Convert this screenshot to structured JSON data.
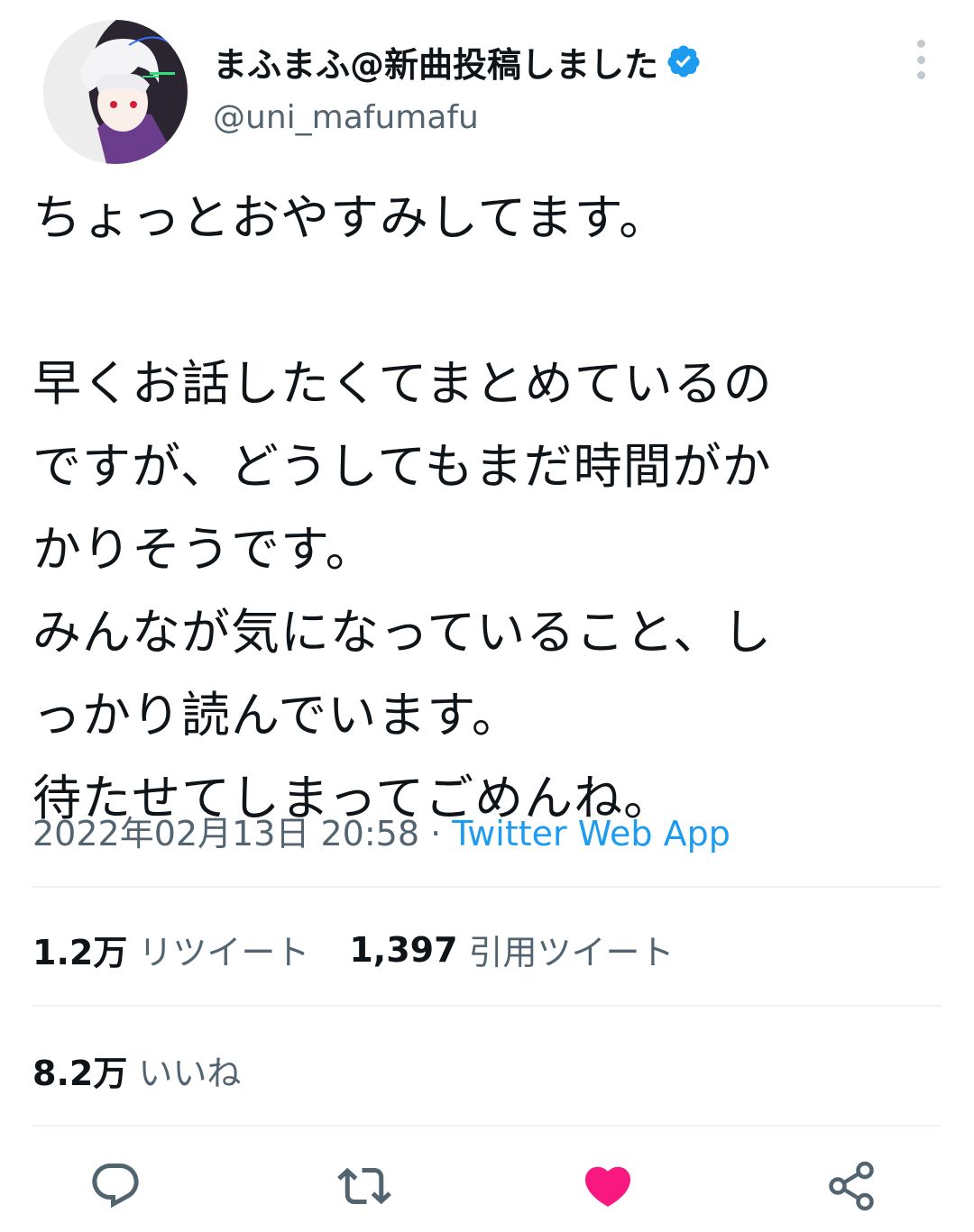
{
  "author": {
    "display_name": "まふまふ@新曲投稿しました",
    "handle": "@uni_mafumafu",
    "verified": true,
    "avatar_icon": "user-avatar"
  },
  "tweet": {
    "text": "ちょっとおやすみしてます。\n\n早くお話したくてまとめているの\nですが、どうしてもまだ時間がか\nかりそうです。\nみんなが気になっていること、し\nっかり読んでいます。\n待たせてしまってごめんね。",
    "timestamp": "2022年02月13日 20:58",
    "separator": " · ",
    "source": "Twitter Web App"
  },
  "stats": {
    "retweets_count": "1.2万",
    "retweets_label": "リツイート",
    "quotes_count": "1,397",
    "quotes_label": "引用ツイート",
    "likes_count": "8.2万",
    "likes_label": "いいね"
  },
  "actions": {
    "reply_icon": "reply-icon",
    "retweet_icon": "retweet-icon",
    "like_icon": "heart-icon",
    "share_icon": "share-icon",
    "liked": true
  },
  "colors": {
    "text": "#0f1419",
    "secondary": "#536471",
    "link": "#1d9bf0",
    "like": "#f91880",
    "divider": "#eff3f4",
    "icon": "#536471"
  }
}
